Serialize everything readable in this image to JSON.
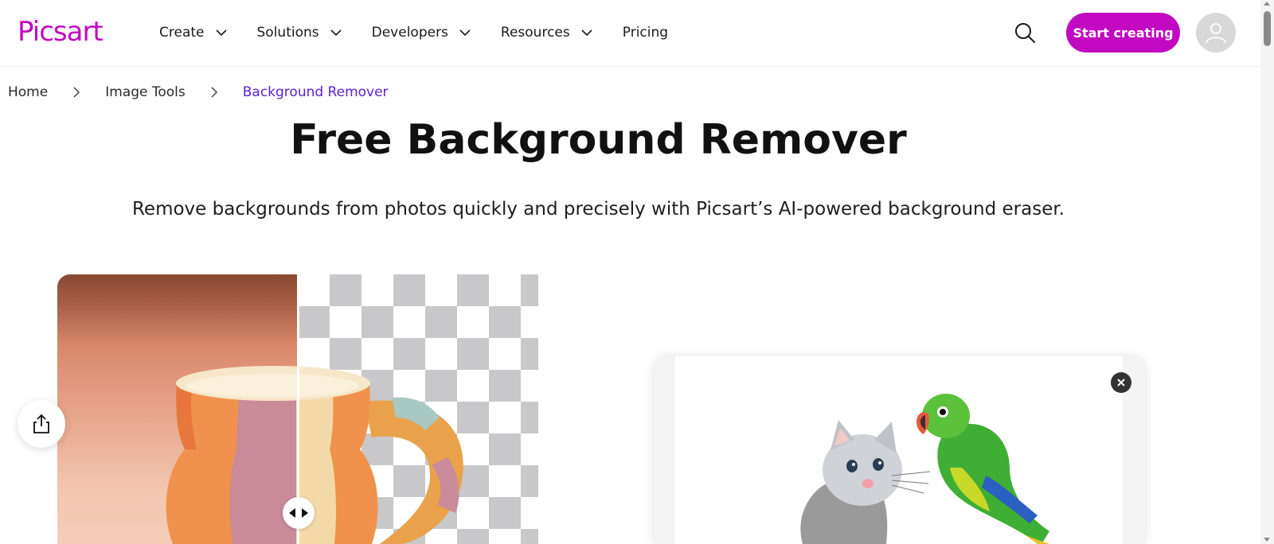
{
  "header": {
    "logo": "Picsart",
    "nav": [
      {
        "label": "Create",
        "has_dropdown": true
      },
      {
        "label": "Solutions",
        "has_dropdown": true
      },
      {
        "label": "Developers",
        "has_dropdown": true
      },
      {
        "label": "Resources",
        "has_dropdown": true
      },
      {
        "label": "Pricing",
        "has_dropdown": false
      }
    ],
    "search_icon": "search-icon",
    "cta_label": "Start creating",
    "avatar_icon": "user-icon"
  },
  "breadcrumb": {
    "items": [
      "Home",
      "Image Tools",
      "Background Remover"
    ]
  },
  "hero": {
    "title": "Free Background Remover",
    "subtitle": "Remove backgrounds from photos quickly and precisely with Picsart’s AI-powered background eraser."
  },
  "demo": {
    "left_image": "mug-with-background",
    "right_image": "mug-transparent-background",
    "compare_handle_icon": "compare-arrows-icon",
    "share_icon": "share-icon"
  },
  "card": {
    "image": "kitten-and-parrot",
    "close_icon": "close-icon"
  },
  "colors": {
    "brand": "#c209c1",
    "breadcrumb_current": "#5b20d6"
  }
}
